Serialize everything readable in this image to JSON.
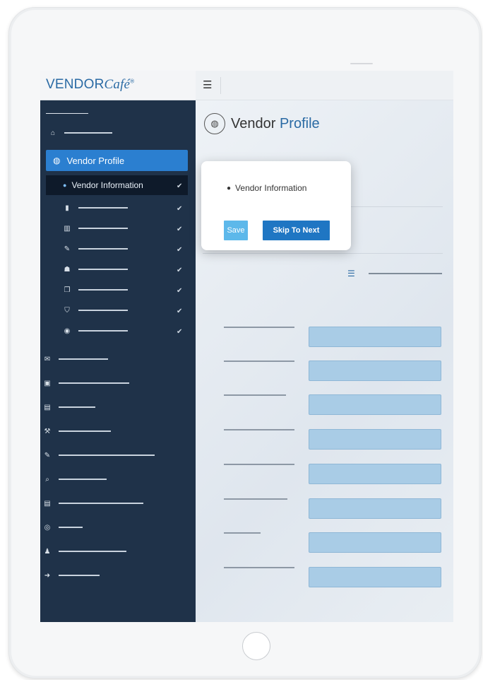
{
  "app": {
    "logo_text": "VENDOR",
    "logo_italic": "Café",
    "logo_mark": "®"
  },
  "toolbar": {
    "menu_toggle_icon": "hamburger-icon"
  },
  "sidebar": {
    "active_section_label": "Vendor Profile",
    "active_item_label": "Vendor Information",
    "section_icon": "dashboard-icon",
    "sub_items_icons": [
      "bookmark-icon",
      "bank-icon",
      "edit-icon",
      "users-icon",
      "copy-icon",
      "shield-icon",
      "check-circle-icon"
    ],
    "bottom_icons": [
      "envelope-icon",
      "briefcase-icon",
      "file-icon",
      "wrench-icon",
      "edit-icon",
      "search-icon",
      "file-icon",
      "lifebuoy-icon",
      "user-icon",
      "sign-out-icon"
    ]
  },
  "page": {
    "title_plain": "Vendor",
    "title_accent": "Profile"
  },
  "modal": {
    "title": "Vendor Information",
    "save_label": "Save",
    "skip_label": "Skip To Next"
  },
  "colors": {
    "sidebar_bg": "#1f3249",
    "accent": "#2b7fd0",
    "save_button": "#5db8ea",
    "skip_button": "#1f76c3"
  }
}
